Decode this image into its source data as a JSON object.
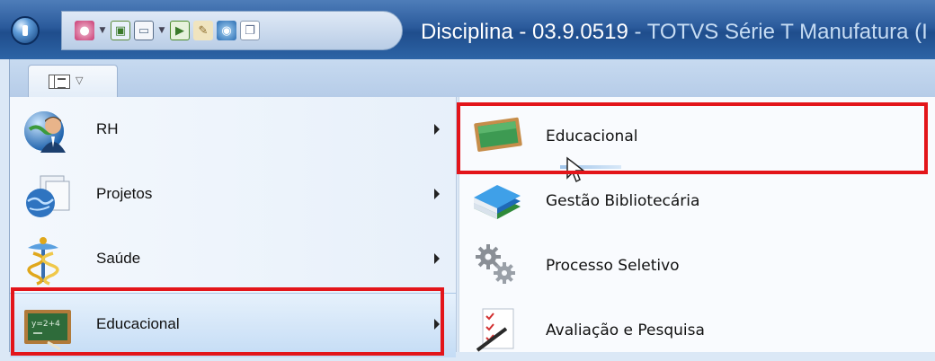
{
  "window": {
    "document_title": "Disciplina - 03.9.0519",
    "app_title": " - TOTVS Série T Manufatura (I"
  },
  "ribbon": {
    "view_tab_icon": "panel-layout-icon"
  },
  "menu": {
    "items": [
      {
        "label": "RH",
        "icon": "rh-person-globe-icon"
      },
      {
        "label": "Projetos",
        "icon": "projetos-globe-docs-icon"
      },
      {
        "label": "Saúde",
        "icon": "saude-caduceus-icon"
      },
      {
        "label": "Educacional",
        "icon": "educacional-chalkboard-icon",
        "selected": true
      }
    ]
  },
  "submenu": {
    "items": [
      {
        "label": "Educacional",
        "icon": "chalkboard-icon",
        "highlighted": true
      },
      {
        "label": "Gestão Bibliotecária",
        "icon": "books-icon"
      },
      {
        "label": "Processo Seletivo",
        "icon": "gears-icon"
      },
      {
        "label": "Avaliação e Pesquisa",
        "icon": "checklist-pen-icon"
      }
    ]
  },
  "colors": {
    "highlight_box": "#e3151a",
    "titlebar": "#2b5b9c"
  }
}
